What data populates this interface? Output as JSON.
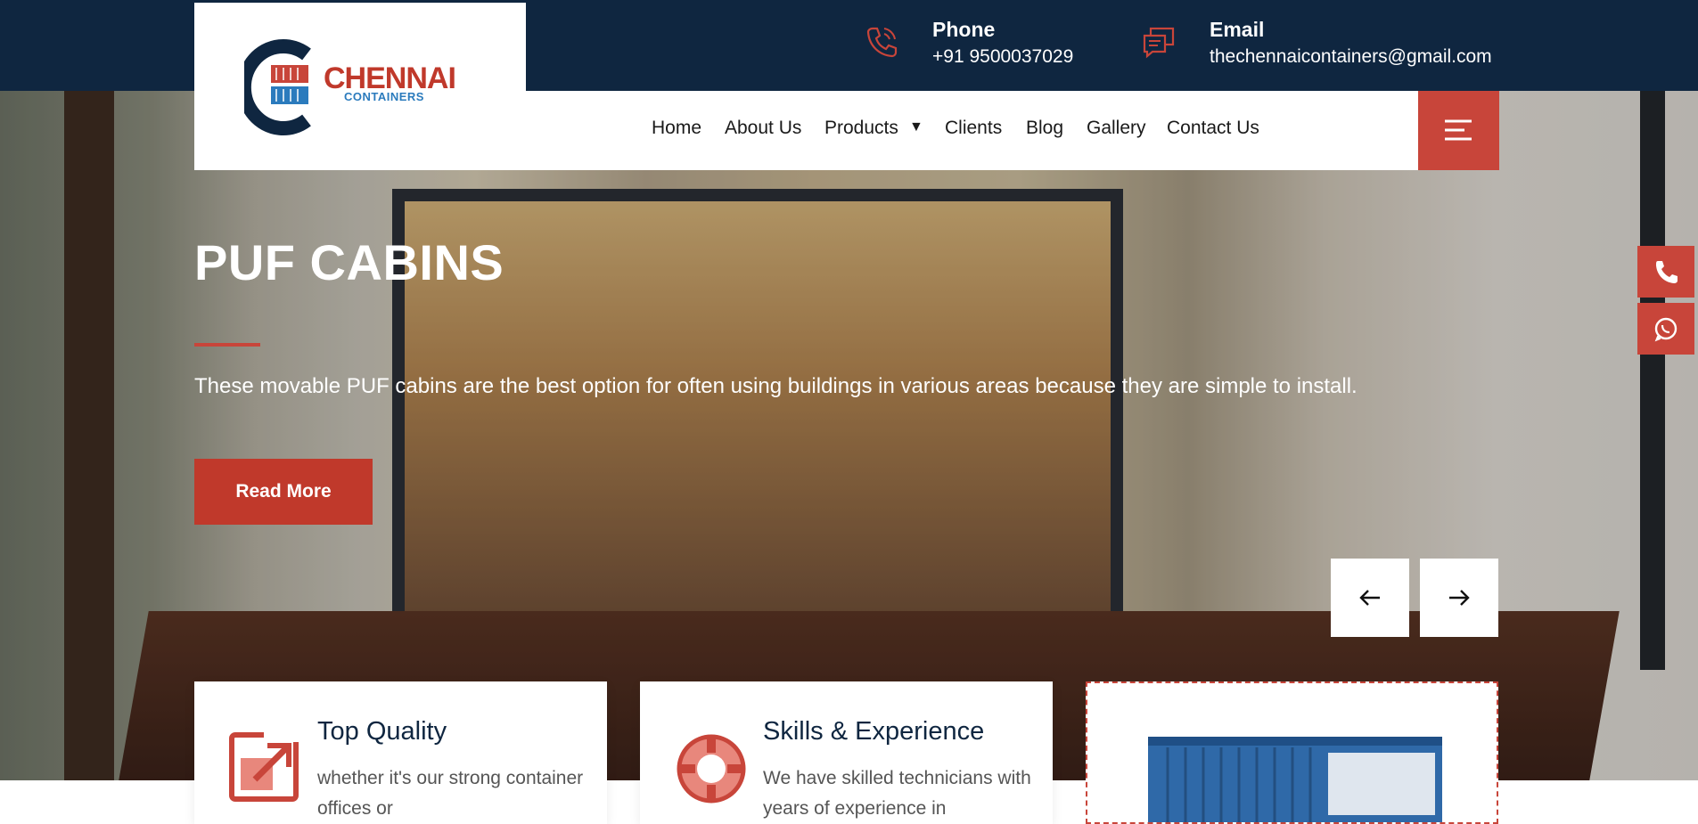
{
  "brand": {
    "name": "CHENNAI",
    "sub": "CONTAINERS",
    "colors": {
      "navy": "#0f2640",
      "accent": "#c8453a",
      "logo_blue": "#2b7bbd"
    }
  },
  "contact": {
    "phone_label": "Phone",
    "phone_value": "+91 9500037029",
    "email_label": "Email",
    "email_value": "thechennaicontainers@gmail.com"
  },
  "nav": {
    "items": [
      "Home",
      "About Us",
      "Products",
      "Clients",
      "Blog",
      "Gallery",
      "Contact Us"
    ],
    "dropdown_indicator": "▼"
  },
  "hero": {
    "title": "PUF CABINS",
    "text": "These movable PUF cabins are the best option for often using buildings in various areas because they are simple to install.",
    "button": "Read More"
  },
  "features": [
    {
      "title": "Top Quality",
      "text": "whether it's our strong container offices or",
      "icon": "quality-icon"
    },
    {
      "title": "Skills & Experience",
      "text": "We have skilled technicians with years of experience in",
      "icon": "lifebuoy-icon"
    }
  ],
  "icons": {
    "phone": "phone-icon",
    "email": "chat-icon",
    "menu": "menu-icon",
    "whatsapp": "whatsapp-icon",
    "prev": "arrow-left-icon",
    "next": "arrow-right-icon"
  }
}
